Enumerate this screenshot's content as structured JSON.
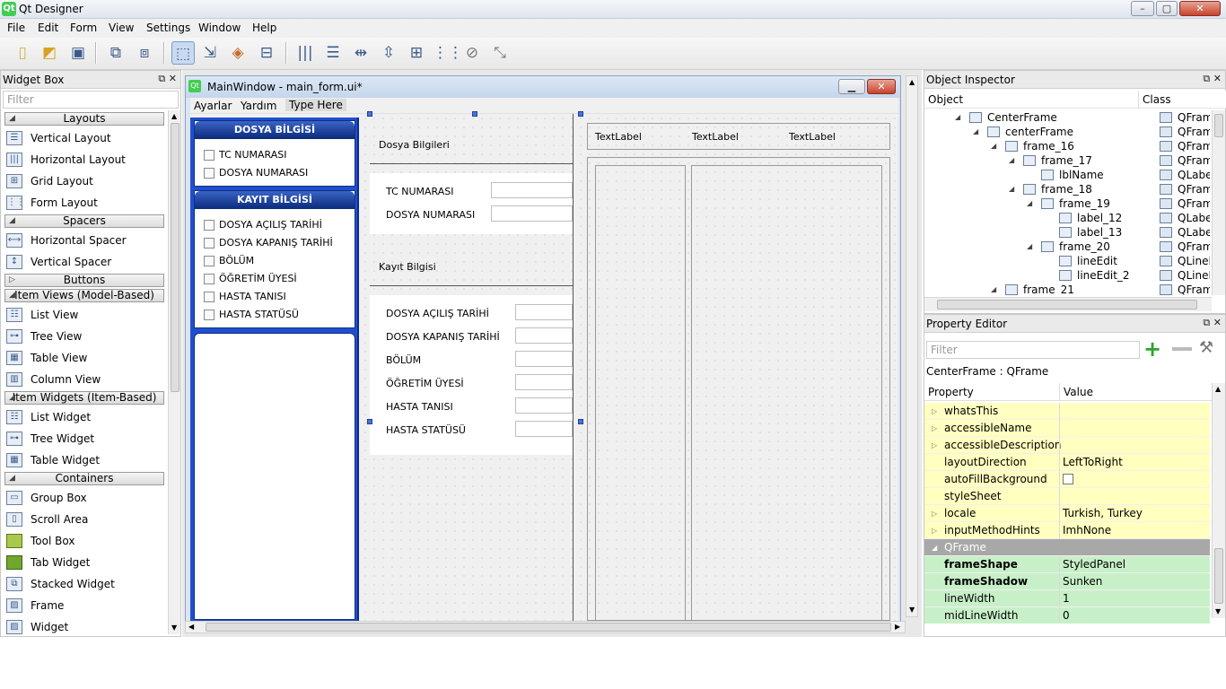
{
  "window": {
    "title": "Qt Designer",
    "app_icon": "Qt",
    "buttons": [
      "–",
      "▢",
      "✕"
    ]
  },
  "menubar": [
    "File",
    "Edit",
    "Form",
    "View",
    "Settings",
    "Window",
    "Help"
  ],
  "toolbar": [
    "new-form-icon",
    "open-form-icon",
    "save-form-icon",
    "send-to-back-icon",
    "bring-to-front-icon",
    "edit-widgets-icon",
    "edit-signals-slots-icon",
    "edit-buddies-icon",
    "edit-tab-order-icon",
    "lay-out-horizontally-icon",
    "lay-out-vertically-icon",
    "lay-out-horizontal-splitter-icon",
    "lay-out-vertical-splitter-icon",
    "lay-out-grid-icon",
    "lay-out-form-icon",
    "break-layout-icon",
    "adjust-size-icon"
  ],
  "widget_box": {
    "title": "Widget Box",
    "filter_placeholder": "Filter",
    "categories": [
      "Layouts",
      "Spacers",
      "Buttons",
      "Item Views (Model-Based)",
      "Item Widgets (Item-Based)",
      "Containers"
    ],
    "items": {
      "vertical_layout": "Vertical Layout",
      "horizontal_layout": "Horizontal Layout",
      "grid_layout": "Grid Layout",
      "form_layout": "Form Layout",
      "horizontal_spacer": "Horizontal Spacer",
      "vertical_spacer": "Vertical Spacer",
      "list_view": "List View",
      "tree_view": "Tree View",
      "table_view": "Table View",
      "column_view": "Column View",
      "list_widget": "List Widget",
      "tree_widget": "Tree Widget",
      "table_widget": "Table Widget",
      "group_box": "Group Box",
      "scroll_area": "Scroll Area",
      "tool_box": "Tool Box",
      "tab_widget": "Tab Widget",
      "stacked_widget": "Stacked Widget",
      "frame": "Frame",
      "widget": "Widget"
    }
  },
  "form_window": {
    "title": "MainWindow - main_form.ui*",
    "menus": [
      "Ayarlar",
      "Yardım",
      "Type Here"
    ],
    "group1": {
      "title": "DOSYA BİLGİSİ",
      "checks": [
        "TC NUMARASI",
        "DOSYA NUMARASI"
      ]
    },
    "group2": {
      "title": "KAYIT BİLGİSİ",
      "checks": [
        "DOSYA AÇILIŞ TARİHİ",
        "DOSYA KAPANIŞ TARİHİ",
        "BÖLÜM",
        "ÖĞRETİM ÜYESİ",
        "HASTA TANISI",
        "HASTA STATÜSÜ"
      ]
    },
    "section1_label": "Dosya Bilgileri",
    "section1_fields": [
      "TC NUMARASI",
      "DOSYA NUMARASI"
    ],
    "section2_label": "Kayıt Bilgisi",
    "section2_fields": [
      "DOSYA AÇILIŞ TARİHİ",
      "DOSYA KAPANIŞ TARİHİ",
      "BÖLÜM",
      "ÖĞRETİM ÜYESİ",
      "HASTA TANISI",
      "HASTA STATÜSÜ"
    ],
    "textlabels": [
      "TextLabel",
      "TextLabel",
      "TextLabel"
    ]
  },
  "object_inspector": {
    "title": "Object Inspector",
    "col_object": "Object",
    "col_class": "Class",
    "rows": [
      {
        "name": "CenterFrame",
        "cls": "QFrame",
        "icon": "frame-icon"
      },
      {
        "name": "centerFrame",
        "cls": "QFrame",
        "icon": "vbox-icon"
      },
      {
        "name": "frame_16",
        "cls": "QFrame",
        "icon": "vbox-icon"
      },
      {
        "name": "frame_17",
        "cls": "QFrame",
        "icon": "vbox-icon"
      },
      {
        "name": "lblName",
        "cls": "QLabel",
        "icon": "label-icon"
      },
      {
        "name": "frame_18",
        "cls": "QFrame",
        "icon": "grid-icon"
      },
      {
        "name": "frame_19",
        "cls": "QFrame",
        "icon": "vbox-icon"
      },
      {
        "name": "label_12",
        "cls": "QLabel",
        "icon": "label-icon"
      },
      {
        "name": "label_13",
        "cls": "QLabel",
        "icon": "label-icon"
      },
      {
        "name": "frame_20",
        "cls": "QFrame",
        "icon": "vbox-icon"
      },
      {
        "name": "lineEdit",
        "cls": "QLineEdit",
        "icon": "lineedit-icon"
      },
      {
        "name": "lineEdit_2",
        "cls": "QLineEdit",
        "icon": "lineedit-icon"
      },
      {
        "name": "frame_21",
        "cls": "QFrame",
        "icon": "vbox-icon"
      }
    ]
  },
  "property_editor": {
    "title": "Property Editor",
    "filter_placeholder": "Filter",
    "object_caption": "CenterFrame : QFrame",
    "col_property": "Property",
    "col_value": "Value",
    "rows": [
      {
        "k": "whatsThis",
        "v": ""
      },
      {
        "k": "accessibleName",
        "v": ""
      },
      {
        "k": "accessibleDescription",
        "v": ""
      },
      {
        "k": "layoutDirection",
        "v": "LeftToRight"
      },
      {
        "k": "autoFillBackground",
        "v": ""
      },
      {
        "k": "styleSheet",
        "v": ""
      },
      {
        "k": "locale",
        "v": "Turkish, Turkey"
      },
      {
        "k": "inputMethodHints",
        "v": "ImhNone"
      }
    ],
    "section": "QFrame",
    "qframe_rows": [
      {
        "k": "frameShape",
        "v": "StyledPanel"
      },
      {
        "k": "frameShadow",
        "v": "Sunken"
      },
      {
        "k": "lineWidth",
        "v": "1"
      },
      {
        "k": "midLineWidth",
        "v": "0"
      }
    ]
  },
  "colors": {
    "accent_blue": "#1f4fd0",
    "prop_yellow": "#ffffc0",
    "prop_green": "#c8f0c8",
    "section_gray": "#a8a8a8"
  }
}
